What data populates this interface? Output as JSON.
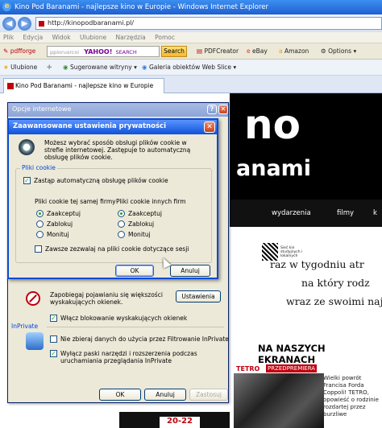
{
  "window": {
    "title": "Kino Pod Baranami - najlepsze kino w Europie - Windows Internet Explorer"
  },
  "address": {
    "url": "http://kinopodbaranami.pl/"
  },
  "menu": [
    "Plik",
    "Edycja",
    "Widok",
    "Ulubione",
    "Narzędzia",
    "Pomoc"
  ],
  "toolbar": {
    "pdfforge_label": "pdfforge",
    "search_placeholder": "ppiorusrcoi",
    "yahoo_label": "YAHOO!",
    "search_label": "SEARCH",
    "search_button": "Search",
    "pdfcreator": "PDFCreator",
    "ebay": "eBay",
    "amazon": "Amazon",
    "options": "Options"
  },
  "favorites": {
    "ulubione": "Ulubione",
    "suggested": "Sugerowane witryny",
    "gallery": "Galeria obiektów Web Slice"
  },
  "tab": {
    "title": "Kino Pod Baranami - najlepsze kino w Europie"
  },
  "site": {
    "logo_top": "no",
    "logo_bottom": "anami",
    "nav": [
      "wydarzenia",
      "filmy",
      "k"
    ],
    "badge": "Sieć kin studyjnych i lokalnych",
    "slogan": [
      "raz w tygodniu atr",
      "na który rodz",
      "wraz ze swoimi naj"
    ],
    "banner": "NA NASZYCH EKRANACH",
    "premiere_left": "TETRO",
    "premiere_badge": "PRZEDPREMIERA",
    "premiere_text": "Wielki powrót Francisa Forda Coppoli! TETRO, opowieść o rodzinie rozdartej przez burzliwe",
    "date": "20-22"
  },
  "options_dialog": {
    "title": "Opcje internetowe",
    "popup_text": "Zapobiegaj pojawianiu się większości wyskakujących okienek.",
    "popup_settings": "Ustawienia",
    "enable_popup_block": "Włącz blokowanie wyskakujących okienek",
    "inprivate_header": "InPrivate",
    "inprivate_filter": "Nie zbieraj danych do użycia przez Filtrowanie InPrivate",
    "inprivate_toolbars": "Wyłącz paski narzędzi i rozszerzenia podczas uruchamiania przeglądania InPrivate",
    "ok": "OK",
    "cancel": "Anuluj",
    "apply": "Zastosuj",
    "help": "?"
  },
  "privacy_dialog": {
    "title": "Zaawansowane ustawienia prywatności",
    "description": "Możesz wybrać sposób obsługi plików cookie w strefie internetowej. Zastępuje to automatyczną obsługę plików cookie.",
    "group_label": "Pliki cookie",
    "override_label": "Zastąp automatyczną obsługę plików cookie",
    "first_party_label": "Pliki cookie tej samej firmy",
    "third_party_label": "Pliki cookie innych firm",
    "accept": "Zaakceptuj",
    "block": "Zablokuj",
    "prompt": "Monituj",
    "session_label": "Zawsze zezwalaj na pliki cookie dotyczące sesji",
    "ok": "OK",
    "cancel": "Anuluj",
    "close_glyph": "✕"
  },
  "colors": {
    "titlebar": "#1f5fd1",
    "dialog_bg": "#ece9d8",
    "accent_red": "#c0000c"
  }
}
